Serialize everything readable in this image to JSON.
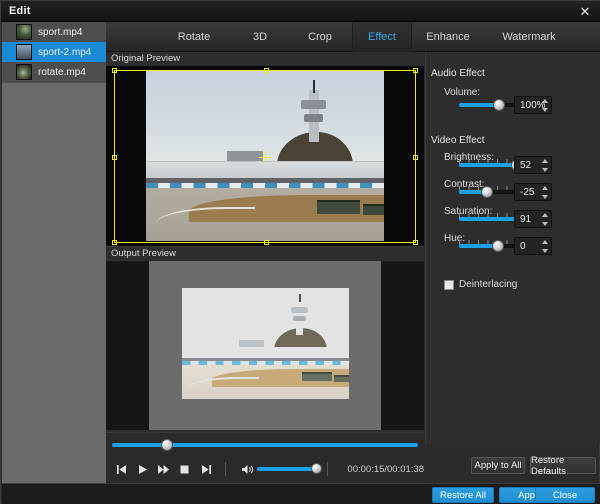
{
  "window": {
    "title": "Edit",
    "close_icon": "close-icon"
  },
  "sidebar": {
    "files": [
      {
        "name": "sport.mp4",
        "selected": false
      },
      {
        "name": "sport-2.mp4",
        "selected": true
      },
      {
        "name": "rotate.mp4",
        "selected": false
      }
    ]
  },
  "tabs": [
    {
      "label": "Rotate",
      "active": false
    },
    {
      "label": "3D",
      "active": false
    },
    {
      "label": "Crop",
      "active": false
    },
    {
      "label": "Effect",
      "active": true
    },
    {
      "label": "Enhance",
      "active": false
    },
    {
      "label": "Watermark",
      "active": false
    }
  ],
  "preview": {
    "original_label": "Original Preview",
    "output_label": "Output Preview"
  },
  "player": {
    "seek_percent": 16,
    "buttons": [
      "previous-icon",
      "play-icon",
      "fast-forward-icon",
      "stop-icon",
      "next-icon"
    ],
    "volume_icon": "speaker-icon",
    "volume_percent": 100,
    "timecode": "00:00:15/00:01:38"
  },
  "settings": {
    "audio_group": "Audio Effect",
    "video_group": "Video Effect",
    "volume": {
      "label": "Volume:",
      "value": "100%",
      "percent": 52
    },
    "brightness": {
      "label": "Brightness:",
      "value": "52",
      "percent": 76
    },
    "contrast": {
      "label": "Contrast:",
      "value": "-25",
      "percent": 37
    },
    "saturation": {
      "label": "Saturation:",
      "value": "91",
      "percent": 96
    },
    "hue": {
      "label": "Hue:",
      "value": "0",
      "percent": 50
    },
    "deinterlacing": {
      "label": "Deinterlacing",
      "checked": false
    },
    "apply_to_all": "Apply to All",
    "restore_defaults": "Restore Defaults"
  },
  "footer": {
    "restore_all": "Restore All",
    "apply": "Apply",
    "close": "Close"
  },
  "colors": {
    "accent": "#1aa0e8",
    "selection": "#1a8ad4",
    "tab_active_text": "#3aa8e8",
    "crop_frame": "#ecec20"
  }
}
